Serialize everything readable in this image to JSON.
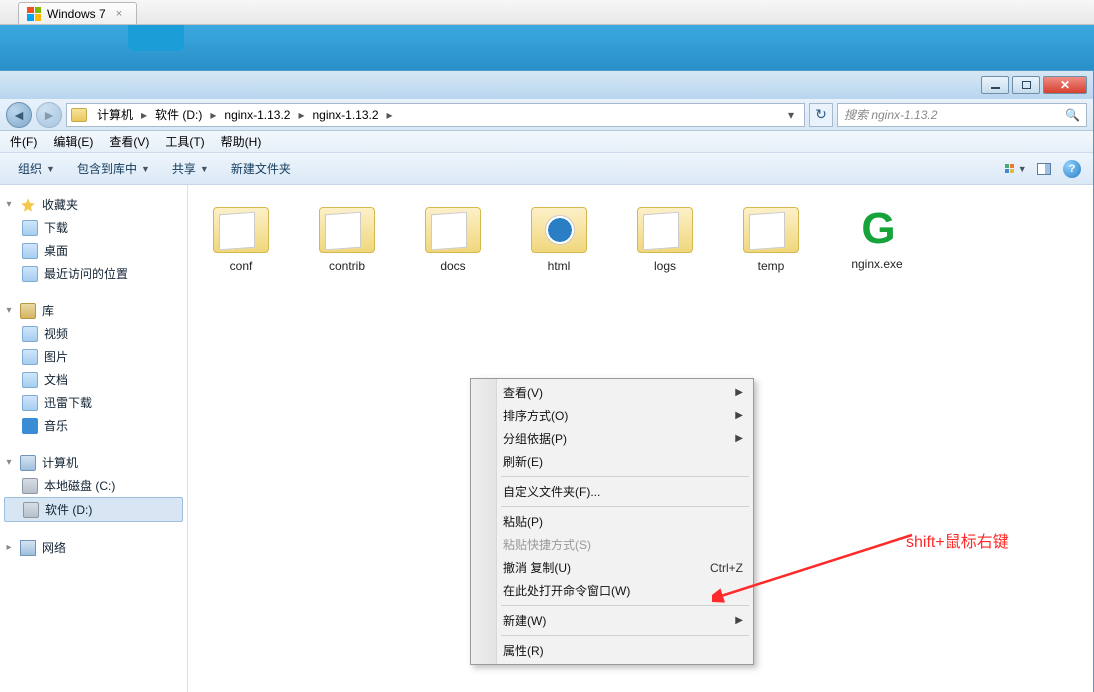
{
  "vm": {
    "tab_label": "Windows 7"
  },
  "window_controls": {
    "close_glyph": "✕"
  },
  "breadcrumb": {
    "segments": [
      "计算机",
      "软件 (D:)",
      "nginx-1.13.2",
      "nginx-1.13.2"
    ]
  },
  "search": {
    "placeholder": "搜索 nginx-1.13.2"
  },
  "menu": {
    "file": "件(F)",
    "edit": "编辑(E)",
    "view": "查看(V)",
    "tools": "工具(T)",
    "help": "帮助(H)"
  },
  "toolbar": {
    "organize": "组织",
    "include": "包含到库中",
    "share": "共享",
    "new_folder": "新建文件夹"
  },
  "sidebar": {
    "favorites": "收藏夹",
    "downloads": "下载",
    "desktop": "桌面",
    "recent": "最近访问的位置",
    "libraries": "库",
    "videos": "视频",
    "pictures": "图片",
    "documents": "文档",
    "thunder": "迅雷下载",
    "music": "音乐",
    "computer": "计算机",
    "drive_c": "本地磁盘 (C:)",
    "drive_d": "软件 (D:)",
    "network": "网络"
  },
  "files": [
    {
      "name": "conf",
      "type": "folder"
    },
    {
      "name": "contrib",
      "type": "folder"
    },
    {
      "name": "docs",
      "type": "folder"
    },
    {
      "name": "html",
      "type": "folder-html"
    },
    {
      "name": "logs",
      "type": "folder"
    },
    {
      "name": "temp",
      "type": "folder"
    },
    {
      "name": "nginx.exe",
      "type": "exe"
    }
  ],
  "context_menu": {
    "view": "查看(V)",
    "sort": "排序方式(O)",
    "group": "分组依据(P)",
    "refresh": "刷新(E)",
    "customize": "自定义文件夹(F)...",
    "paste": "粘贴(P)",
    "paste_shortcut": "粘贴快捷方式(S)",
    "undo_copy": "撤消 复制(U)",
    "undo_shortcut": "Ctrl+Z",
    "open_cmd": "在此处打开命令窗口(W)",
    "new": "新建(W)",
    "properties": "属性(R)"
  },
  "annotation": {
    "text": "shift+鼠标右键"
  }
}
